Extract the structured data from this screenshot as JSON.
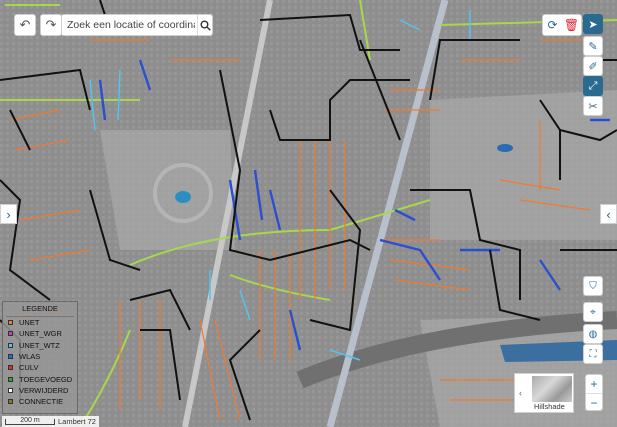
{
  "toolbar": {
    "undo_icon": "undo-icon",
    "redo_icon": "redo-icon",
    "search_placeholder": "Zoek een locatie of coordinaten",
    "search_icon": "search-icon"
  },
  "top_right": {
    "refresh_icon": "refresh-icon",
    "delete_icon": "trash-icon"
  },
  "tools": [
    "select-cursor-icon",
    "pencil-icon",
    "edit-icon",
    "connect-icon",
    "scissors-icon",
    "filter-icon",
    "location-pin-icon",
    "globe-icon",
    "fullscreen-icon"
  ],
  "legend": {
    "title": "LEGENDE",
    "items": [
      {
        "label": "UNET",
        "color": "#f07a2e"
      },
      {
        "label": "UNET_WGR",
        "color": "#c040c0"
      },
      {
        "label": "UNET_WTZ",
        "color": "#55c3f0"
      },
      {
        "label": "WLAS",
        "color": "#2a6ad0"
      },
      {
        "label": "CULV",
        "color": "#e03030"
      },
      {
        "label": "TOEGEVOEGD",
        "color": "#2aa830"
      },
      {
        "label": "VERWIJDERD",
        "color": "#ffffff"
      },
      {
        "label": "CONNECTIE",
        "color": "#8a7a2a"
      }
    ]
  },
  "scale": {
    "distance": "200 m",
    "projection": "Lambert 72"
  },
  "basemap": {
    "label": "Hillshade"
  },
  "zoom": {
    "in": "+",
    "out": "−"
  },
  "colors": {
    "boundary": "#111111",
    "unet": "#f07a2e",
    "unet_wtz": "#55c3f0",
    "wlas": "#2a4fd0",
    "road": "#a6d84a",
    "active_tool": "#2b6a8f"
  }
}
